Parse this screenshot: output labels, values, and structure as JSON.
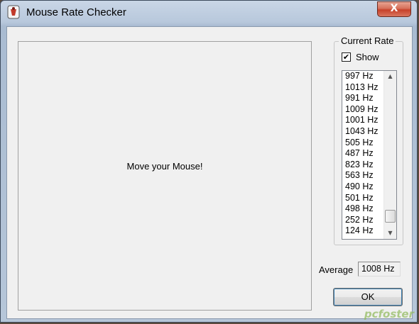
{
  "window": {
    "title": "Mouse Rate Checker",
    "close_label": "X"
  },
  "canvas": {
    "message": "Move your Mouse!"
  },
  "current_rate": {
    "group_title": "Current Rate",
    "show_label": "Show",
    "show_checked": true,
    "check_mark": "✔",
    "items": [
      "997 Hz",
      "1013 Hz",
      "991 Hz",
      "1009 Hz",
      "1001 Hz",
      "1043 Hz",
      "505 Hz",
      "487 Hz",
      "823 Hz",
      "563 Hz",
      "490 Hz",
      "501 Hz",
      "498 Hz",
      "252 Hz",
      "124 Hz"
    ]
  },
  "average": {
    "label": "Average",
    "value": "1008 Hz"
  },
  "ok_label": "OK",
  "watermark": "pcfoster",
  "icons": {
    "up": "▲",
    "down": "▼"
  }
}
